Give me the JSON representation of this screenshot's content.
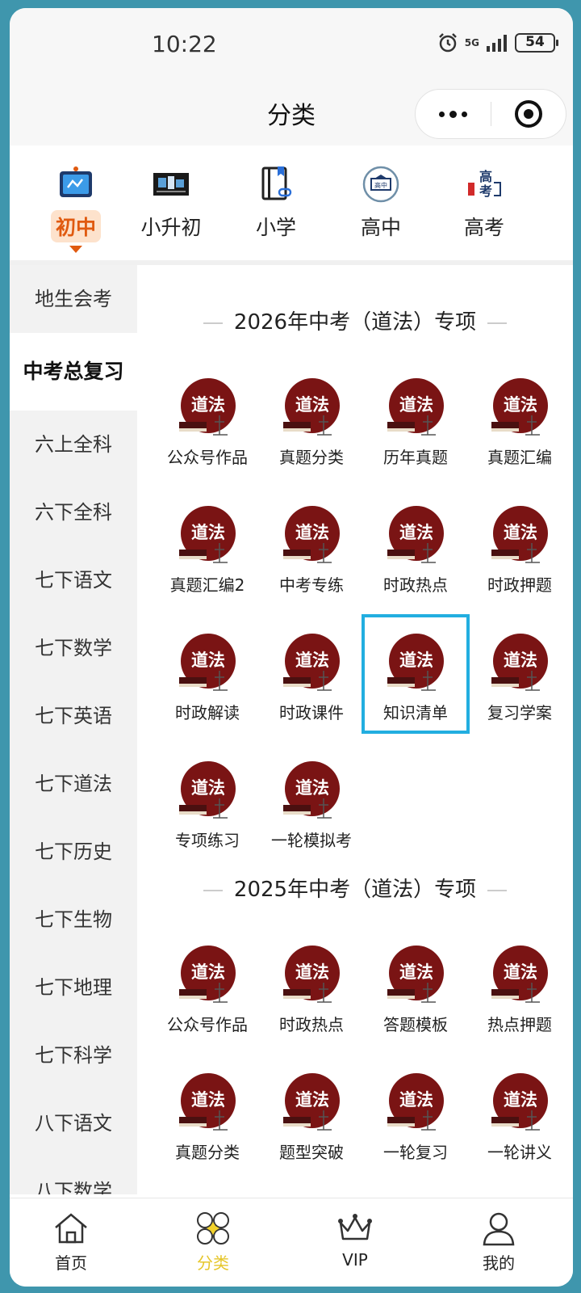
{
  "status_bar": {
    "time": "10:22",
    "network": "5G",
    "battery": "54"
  },
  "title_bar": {
    "title": "分类"
  },
  "level_tabs": [
    {
      "label": "初中",
      "icon": "classroom-board-icon",
      "active": true
    },
    {
      "label": "小升初",
      "icon": "classroom-photo-icon",
      "active": false
    },
    {
      "label": "小学",
      "icon": "book-link-icon",
      "active": false
    },
    {
      "label": "高中",
      "icon": "graduation-cap-icon",
      "active": false
    },
    {
      "label": "高考",
      "icon": "gaokao-icon",
      "active": false
    }
  ],
  "sidebar": {
    "items": [
      "地生会考",
      "中考总复习",
      "六上全科",
      "六下全科",
      "七下语文",
      "七下数学",
      "七下英语",
      "七下道法",
      "七下历史",
      "七下生物",
      "七下地理",
      "七下科学",
      "八下语文",
      "八下数学"
    ],
    "active_index": 1
  },
  "sections": [
    {
      "title": "2026年中考（道法）专项",
      "items": [
        "公众号作品",
        "真题分类",
        "历年真题",
        "真题汇编",
        "真题汇编2",
        "中考专练",
        "时政热点",
        "时政押题",
        "时政解读",
        "时政课件",
        "知识清单",
        "复习学案",
        "专项练习",
        "一轮模拟考"
      ],
      "highlighted_index": 10
    },
    {
      "title": "2025年中考（道法）专项",
      "items": [
        "公众号作品",
        "时政热点",
        "答题模板",
        "热点押题",
        "真题分类",
        "题型突破",
        "一轮复习",
        "一轮讲义"
      ]
    }
  ],
  "badge_text": "道法",
  "bottom_nav": [
    {
      "label": "首页",
      "icon": "home-icon",
      "active": false
    },
    {
      "label": "分类",
      "icon": "category-icon",
      "active": true
    },
    {
      "label": "VIP",
      "icon": "crown-icon",
      "active": false
    },
    {
      "label": "我的",
      "icon": "user-icon",
      "active": false
    }
  ],
  "colors": {
    "accent_orange": "#e05a10",
    "accent_yellow": "#e6c62a",
    "badge_red": "#7a1414",
    "highlight_blue": "#22aee0"
  }
}
